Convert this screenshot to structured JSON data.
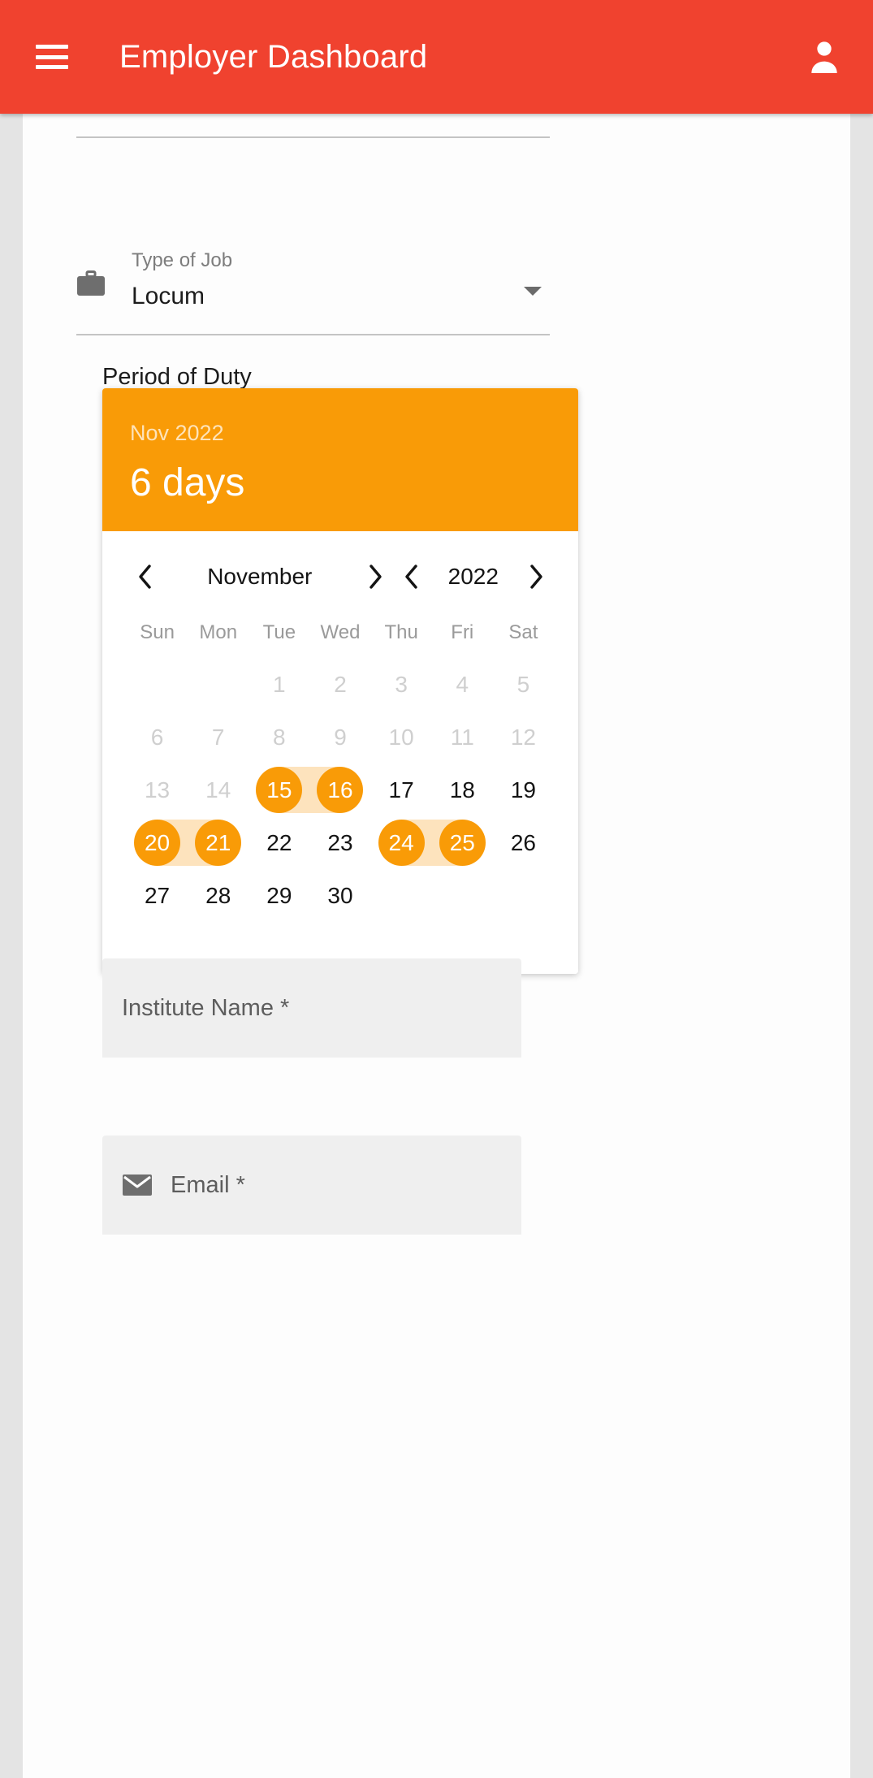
{
  "appbar": {
    "title": "Employer Dashboard",
    "menu_icon": "hamburger-menu-icon",
    "account_icon": "person-icon",
    "background_color": "#f0422f"
  },
  "form": {
    "job_type": {
      "icon": "briefcase-icon",
      "label": "Type of Job",
      "value": "Locum",
      "dropdown_icon": "dropdown-arrow-icon"
    },
    "period_label": "Period of Duty",
    "institute": {
      "placeholder": "Institute Name *"
    },
    "email": {
      "icon": "envelope-icon",
      "placeholder": "Email *"
    }
  },
  "calendar": {
    "accent_color": "#f99b07",
    "range_band_color": "#fde3bd",
    "header": {
      "month_year": "Nov 2022",
      "duration": "6 days"
    },
    "nav": {
      "prev_month_icon": "chevron-left-icon",
      "month": "November",
      "next_month_icon": "chevron-right-icon",
      "prev_year_icon": "chevron-left-icon",
      "year": "2022",
      "next_year_icon": "chevron-right-icon"
    },
    "weekdays": [
      "Sun",
      "Mon",
      "Tue",
      "Wed",
      "Thu",
      "Fri",
      "Sat"
    ],
    "weeks": [
      [
        {
          "day": "",
          "state": "empty"
        },
        {
          "day": "",
          "state": "empty"
        },
        {
          "day": "1",
          "state": "disabled"
        },
        {
          "day": "2",
          "state": "disabled"
        },
        {
          "day": "3",
          "state": "disabled"
        },
        {
          "day": "4",
          "state": "disabled"
        },
        {
          "day": "5",
          "state": "disabled"
        }
      ],
      [
        {
          "day": "6",
          "state": "disabled"
        },
        {
          "day": "7",
          "state": "disabled"
        },
        {
          "day": "8",
          "state": "disabled"
        },
        {
          "day": "9",
          "state": "disabled"
        },
        {
          "day": "10",
          "state": "disabled"
        },
        {
          "day": "11",
          "state": "disabled"
        },
        {
          "day": "12",
          "state": "disabled"
        }
      ],
      [
        {
          "day": "13",
          "state": "disabled"
        },
        {
          "day": "14",
          "state": "disabled"
        },
        {
          "day": "15",
          "state": "selected",
          "band": "right"
        },
        {
          "day": "16",
          "state": "selected",
          "band": "left"
        },
        {
          "day": "17",
          "state": "available"
        },
        {
          "day": "18",
          "state": "available"
        },
        {
          "day": "19",
          "state": "available"
        }
      ],
      [
        {
          "day": "20",
          "state": "selected",
          "band": "right"
        },
        {
          "day": "21",
          "state": "selected",
          "band": "left"
        },
        {
          "day": "22",
          "state": "available"
        },
        {
          "day": "23",
          "state": "available"
        },
        {
          "day": "24",
          "state": "selected",
          "band": "right"
        },
        {
          "day": "25",
          "state": "selected",
          "band": "left"
        },
        {
          "day": "26",
          "state": "available"
        }
      ],
      [
        {
          "day": "27",
          "state": "available"
        },
        {
          "day": "28",
          "state": "available"
        },
        {
          "day": "29",
          "state": "available"
        },
        {
          "day": "30",
          "state": "available"
        },
        {
          "day": "",
          "state": "empty"
        },
        {
          "day": "",
          "state": "empty"
        },
        {
          "day": "",
          "state": "empty"
        }
      ]
    ],
    "selected_days": [
      15,
      16,
      20,
      21,
      24,
      25
    ]
  }
}
